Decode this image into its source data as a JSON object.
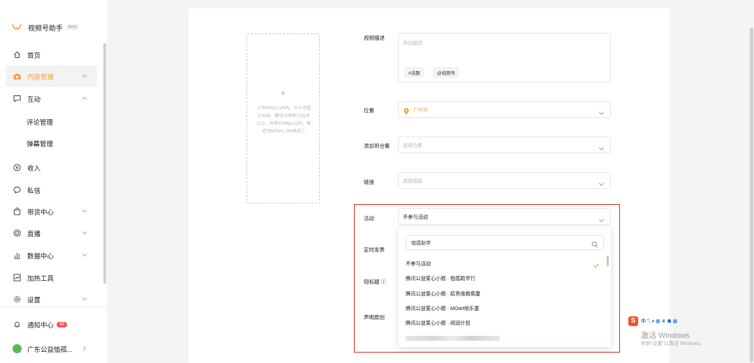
{
  "app": {
    "title": "视频号助手",
    "badge": "beta"
  },
  "sidebar": {
    "home": "首页",
    "content_management": "内容管理",
    "interaction": "互动",
    "comment_management": "评论管理",
    "danmaku_management": "弹幕管理",
    "income": "收入",
    "messages": "私信",
    "shopping_center": "带货中心",
    "live": "直播",
    "data_center": "数据中心",
    "boost_tools": "加热工具",
    "settings": "设置",
    "notification_center": "通知中心",
    "notification_count": "49",
    "account_name": "广东公益恤孤..."
  },
  "upload": {
    "plus": "+",
    "hint": "上传时长2小时内，大小不超过4GB，建议分辨率720p及以上，码率10Mbps以内，格式为MP4/H.264格式ⓘ"
  },
  "form": {
    "description_label": "视频描述",
    "description_placeholder": "添加描述",
    "topic_tag": "#话题",
    "mention_tag": "@视频号",
    "location_label": "位置",
    "location_value": "广州市",
    "collection_label": "添加到合集",
    "collection_placeholder": "选择合集",
    "link_label": "链接",
    "link_placeholder": "选择链接",
    "activity_label": "活动",
    "activity_value": "不参与活动",
    "schedule_label": "定时发表",
    "short_title_label": "短标题 ⓘ",
    "original_label": "声明原创"
  },
  "dropdown": {
    "search_value": "恤孤助学",
    "options": [
      "不参与活动",
      "腾讯公益爱心小报 · 恤孤助学行",
      "腾讯公益爱心小报 · 結善缘救病童",
      "腾讯公益爱心小报 · MOart绘乐童",
      "腾讯公益爱心小报 · 阅动计划"
    ],
    "selected_index": 0
  },
  "watermark": {
    "title": "激活 Windows",
    "subtitle": "转到\"设置\"以激活 Windows。",
    "ime_icons": "中 °, ♦ ▦ ❦ ☗ ▦"
  },
  "colors": {
    "accent": "#fa9d3b",
    "highlight": "#e02020",
    "badge": "#fa5151"
  }
}
